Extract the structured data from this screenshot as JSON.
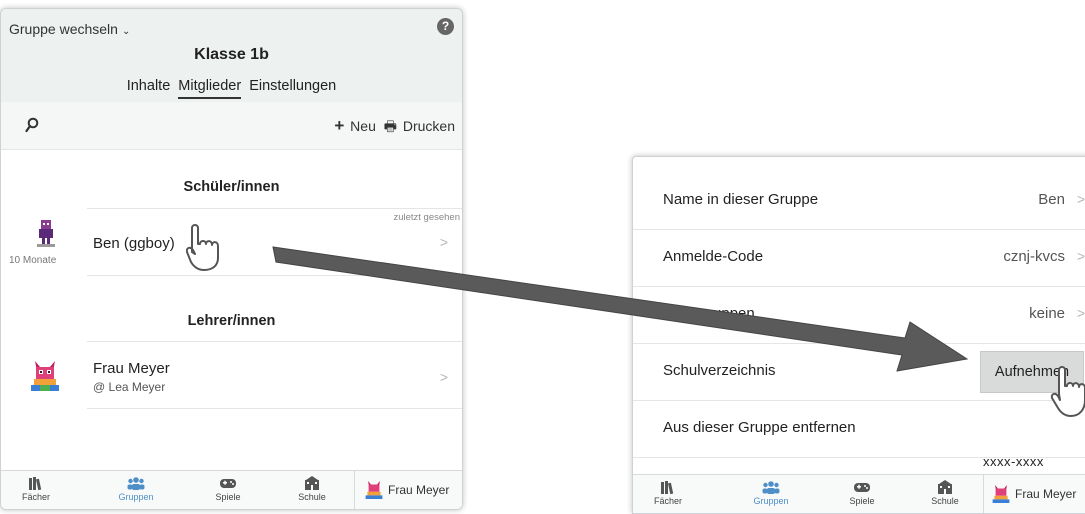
{
  "left": {
    "group_switch_label": "Gruppe wechseln",
    "help_label": "?",
    "group_title": "Klasse 1b",
    "tabs": [
      "Inhalte",
      "Mitglieder",
      "Einstellungen"
    ],
    "active_tab": "Mitglieder",
    "toolbar": {
      "new_label": "Neu",
      "print_label": "Drucken"
    },
    "students_heading": "Schüler/innen",
    "last_seen_header": "zuletzt gesehen",
    "students": [
      {
        "name": "Ben (ggboy)",
        "avatar_caption": "10 Monate"
      }
    ],
    "teachers_heading": "Lehrer/innen",
    "teachers": [
      {
        "name": "Frau Meyer",
        "handle": "@ Lea Meyer"
      }
    ]
  },
  "bottom_nav": {
    "items": [
      {
        "label": "Fächer",
        "icon": "books-icon"
      },
      {
        "label": "Gruppen",
        "icon": "group-icon",
        "active": true
      },
      {
        "label": "Spiele",
        "icon": "gamepad-icon"
      },
      {
        "label": "Schule",
        "icon": "school-icon"
      }
    ],
    "user_name": "Frau Meyer"
  },
  "right": {
    "rows": [
      {
        "label": "Name in dieser Gruppe",
        "value": "Ben"
      },
      {
        "label": "Anmelde-Code",
        "value": "cznj-kvcs"
      },
      {
        "label": "Untergruppen",
        "value": "keine"
      },
      {
        "label": "Schulverzeichnis",
        "button": "Aufnehmen"
      },
      {
        "label": "Aus dieser Gruppe entfernen"
      }
    ],
    "code_placeholder": "xxxx-xxxx"
  },
  "colors": {
    "active_nav": "#4e8fc8",
    "header_bg": "#edf1f0",
    "arrow": "#5a5a5a"
  }
}
